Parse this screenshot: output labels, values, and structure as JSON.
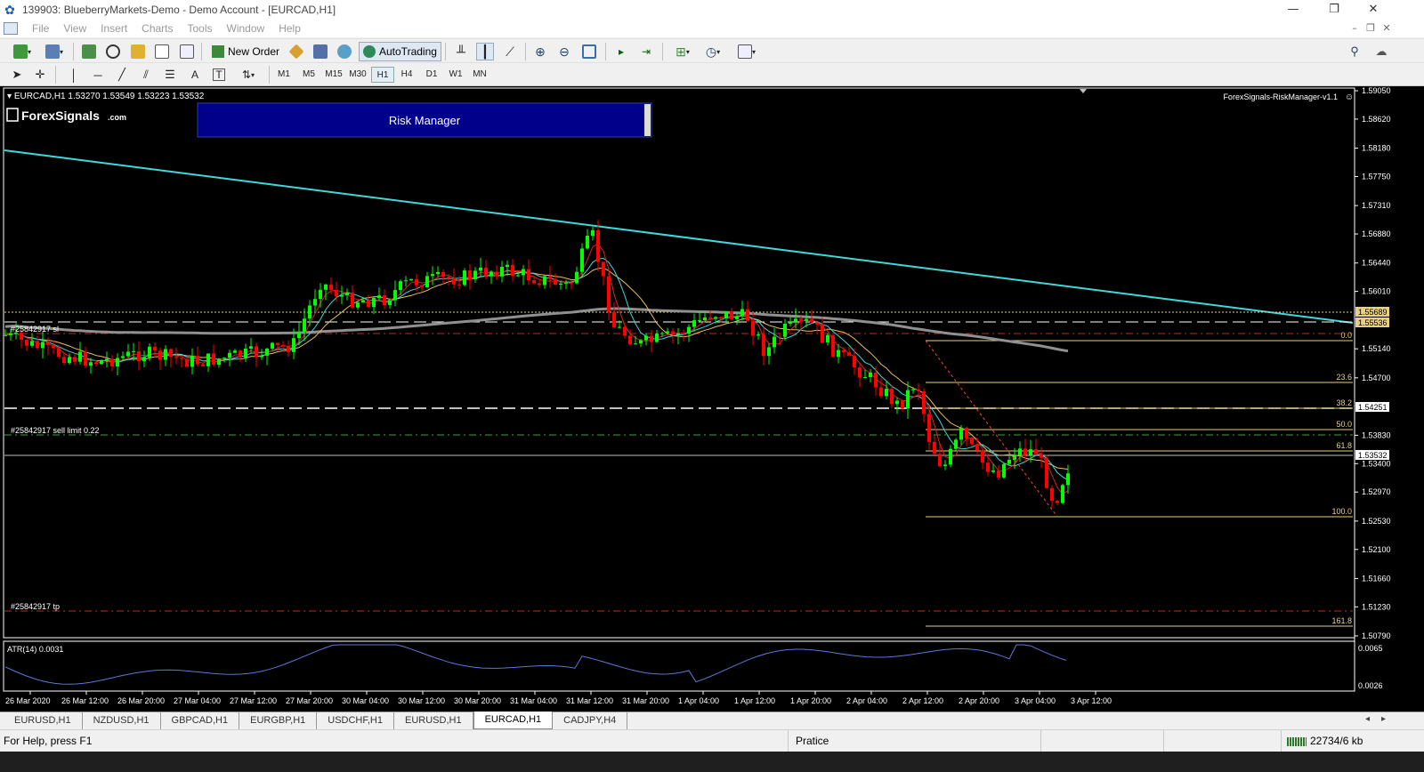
{
  "window": {
    "title": "139903: BlueberryMarkets-Demo - Demo Account - [EURCAD,H1]",
    "minimize": "—",
    "restore": "❐",
    "close": "✕"
  },
  "menu": [
    "File",
    "View",
    "Insert",
    "Charts",
    "Tools",
    "Window",
    "Help"
  ],
  "toolbar": {
    "new_order": "New Order",
    "autotrading": "AutoTrading"
  },
  "timeframes": [
    "M1",
    "M5",
    "M15",
    "M30",
    "H1",
    "H4",
    "D1",
    "W1",
    "MN"
  ],
  "active_timeframe": "H1",
  "chart": {
    "symbol_info": "EURCAD,H1  1.53270 1.53549 1.53223 1.53532",
    "logo_text": "ForexSignals",
    "logo_suffix": ".com",
    "risk_manager_label": "Risk Manager",
    "ea_label": "ForexSignals-RiskManager-v1.1",
    "order_sell_limit": "#25842917 sell limit 0.22",
    "order_tp": "#25842917 tp",
    "order_sl": "#25842917 sl",
    "indicator_label": "ATR(14) 0.0031",
    "current_price": "1.53532",
    "price_levels": [
      "1.59050",
      "1.58620",
      "1.58180",
      "1.57750",
      "1.57310",
      "1.56880",
      "1.56440",
      "1.56010",
      "1.55140",
      "1.54700",
      "1.53830",
      "1.53400",
      "1.52970",
      "1.52530",
      "1.52100",
      "1.51660",
      "1.51230",
      "1.50790"
    ],
    "price_tags": {
      "upper": "1.55689",
      "middle": "1.55536",
      "lower": "1.54251"
    },
    "fib_levels": [
      "0.0",
      "23.6",
      "38.2",
      "50.0",
      "61.8",
      "100.0",
      "161.8"
    ],
    "atr_scale": [
      "0.0065",
      "0.0026"
    ],
    "time_labels": [
      "26 Mar 2020",
      "26 Mar 12:00",
      "26 Mar 20:00",
      "27 Mar 04:00",
      "27 Mar 12:00",
      "27 Mar 20:00",
      "30 Mar 04:00",
      "30 Mar 12:00",
      "30 Mar 20:00",
      "31 Mar 04:00",
      "31 Mar 12:00",
      "31 Mar 20:00",
      "1 Apr 04:00",
      "1 Apr 12:00",
      "1 Apr 20:00",
      "2 Apr 04:00",
      "2 Apr 12:00",
      "2 Apr 20:00",
      "3 Apr 04:00",
      "3 Apr 12:00"
    ],
    "colors": {
      "background": "#000000",
      "bull": "#00ff00",
      "bear": "#ff0000",
      "trendline": "#40d8d8",
      "fib": "#e8d080",
      "atr": "#5b78d8"
    }
  },
  "tabs": [
    "EURUSD,H1",
    "NZDUSD,H1",
    "GBPCAD,H1",
    "EURGBP,H1",
    "USDCHF,H1",
    "EURUSD,H1",
    "EURCAD,H1",
    "CADJPY,H4"
  ],
  "active_tab": "EURCAD,H1",
  "status": {
    "help": "For Help, press F1",
    "profile": "Pratice",
    "traffic": "22734/6 kb"
  }
}
